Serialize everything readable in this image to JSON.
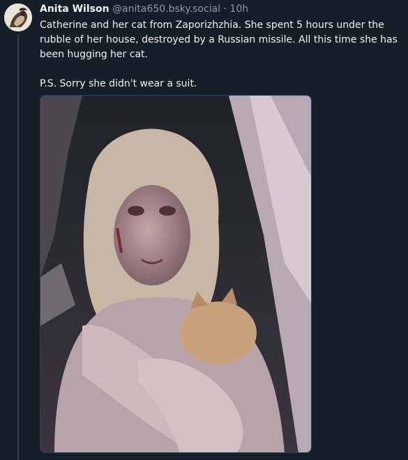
{
  "post": {
    "author": {
      "display_name": "Anita Wilson",
      "handle": "@anita650.bsky.social",
      "separator": "·",
      "time": "10h"
    },
    "text_paragraphs": [
      "Catherine and her cat from Zaporizhzhia. She spent 5 hours under the rubble of her house, destroyed by a Russian missile. All this time she has been hugging her cat.",
      "P.S. Sorry she didn't wear a suit."
    ],
    "media": {
      "kind": "photo"
    }
  }
}
